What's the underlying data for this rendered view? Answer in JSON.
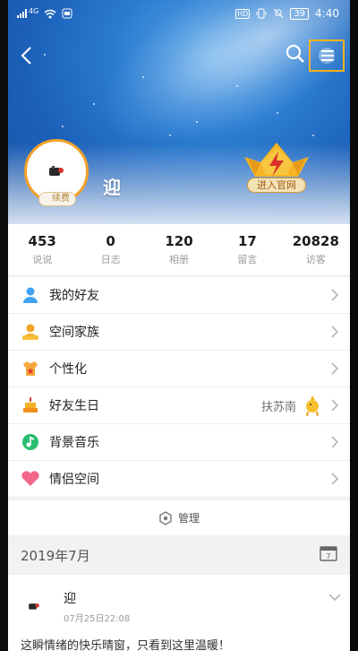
{
  "status_bar": {
    "network": "4G",
    "hd": "HD",
    "battery": "39",
    "time": "4:40"
  },
  "header": {
    "icons": {
      "back": "back-arrow-icon",
      "search": "search-icon",
      "menu": "menu-icon"
    },
    "avatar_badge": "续费",
    "nickname": "迎",
    "vip_label": "进入官网"
  },
  "stats": [
    {
      "value": "453",
      "label": "说说"
    },
    {
      "value": "0",
      "label": "日志"
    },
    {
      "value": "120",
      "label": "相册"
    },
    {
      "value": "17",
      "label": "留言"
    },
    {
      "value": "20828",
      "label": "访客"
    }
  ],
  "menu": [
    {
      "label": "我的好友",
      "icon": "friends-icon"
    },
    {
      "label": "空间家族",
      "icon": "family-icon"
    },
    {
      "label": "个性化",
      "icon": "personalize-icon"
    },
    {
      "label": "好友生日",
      "icon": "birthday-cake-icon",
      "value": "扶苏南"
    },
    {
      "label": "背景音乐",
      "icon": "music-icon"
    },
    {
      "label": "情侣空间",
      "icon": "heart-icon"
    }
  ],
  "manage": {
    "label": "管理"
  },
  "feed": {
    "month": "2019年7月",
    "calendar_day": "7",
    "item": {
      "name": "迎",
      "time": "07月25日22:08",
      "text": "这瞬情绪的快乐晴窗，只看到这里温暖！"
    }
  },
  "colors": {
    "accent_orange": "#f3a12b",
    "highlight_box": "#f2b318",
    "vip_gold": "#f5b423"
  }
}
